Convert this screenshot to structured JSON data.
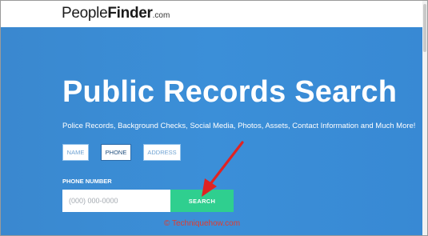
{
  "header": {
    "logo_part1": "People",
    "logo_part2": "Finder",
    "logo_part3": ".com"
  },
  "hero": {
    "title": "Public Records Search",
    "subtitle": "Police Records, Background Checks, Social Media, Photos, Assets, Contact Information and Much More!"
  },
  "search_tabs": [
    {
      "label": "NAME",
      "active": false
    },
    {
      "label": "PHONE",
      "active": true
    },
    {
      "label": "ADDRESS",
      "active": false
    }
  ],
  "form": {
    "field_label": "PHONE NUMBER",
    "input_placeholder": "(000) 000-0000",
    "input_value": "",
    "search_label": "SEARCH"
  },
  "watermark": "© Techniquehow.com",
  "colors": {
    "hero_blue": "#3b8fd8",
    "search_green": "#2fcf8f",
    "arrow_red": "#e02323"
  }
}
